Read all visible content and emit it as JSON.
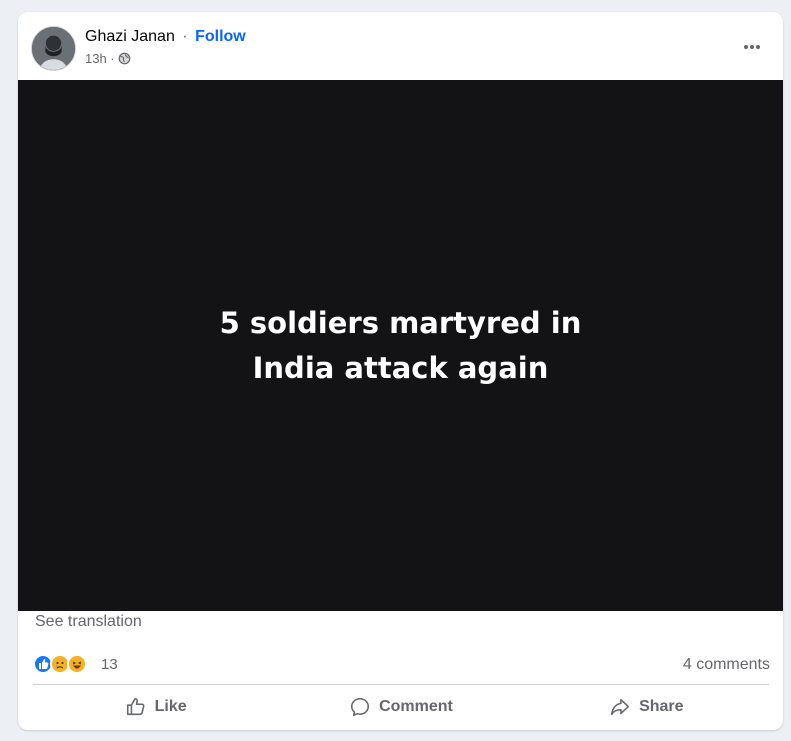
{
  "post": {
    "author": "Ghazi Janan",
    "separator": "·",
    "follow_label": "Follow",
    "time": "13h ·",
    "privacy_icon": "globe-icon",
    "more_icon": "more-options-icon",
    "media_text": "5 soldiers martyred in India attack again",
    "see_translation": "See translation"
  },
  "reactions": {
    "icons": [
      "like-icon",
      "sad-icon",
      "haha-icon"
    ],
    "count": "13",
    "comments": "4 comments"
  },
  "actions": {
    "like_label": "Like",
    "comment_label": "Comment",
    "share_label": "Share"
  },
  "colors": {
    "accent": "#0866ff",
    "media_bg": "#131315",
    "secondary_text": "#65676b"
  }
}
